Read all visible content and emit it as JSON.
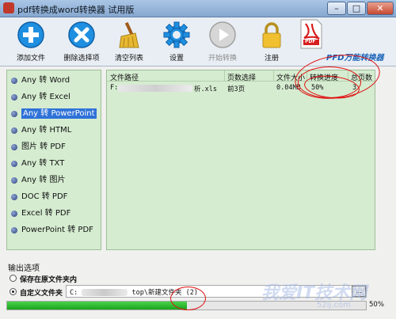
{
  "window": {
    "title": "pdf转换成word转换器 试用版"
  },
  "toolbar": {
    "add": "添加文件",
    "delete": "删除选择项",
    "clear": "清空列表",
    "settings": "设置",
    "start": "开始转换",
    "register": "注册",
    "brand": "PFD万能转换器",
    "pdf_label": "PDF"
  },
  "sidebar": {
    "items": [
      {
        "label": "Any 转 Word"
      },
      {
        "label": "Any 转 Excel"
      },
      {
        "label": "Any 转 PowerPoint"
      },
      {
        "label": "Any 转 HTML"
      },
      {
        "label": "图片 转 PDF"
      },
      {
        "label": "Any 转 TXT"
      },
      {
        "label": "Any 转 图片"
      },
      {
        "label": "DOC 转 PDF"
      },
      {
        "label": "Excel 转 PDF"
      },
      {
        "label": "PowerPoint 转 PDF"
      }
    ]
  },
  "table": {
    "columns": [
      "文件路径",
      "页数选择",
      "文件大小",
      "转换进度",
      "总页数"
    ],
    "rows": [
      {
        "path_prefix": "F:",
        "path_suffix": "析.xls",
        "pages": "前3页",
        "size": "0.04MB",
        "progress": "50%",
        "total": "3"
      }
    ]
  },
  "output": {
    "label": "输出选项",
    "option_original": "保存在原文件夹内",
    "option_custom": "自定义文件夹",
    "path_prefix": "C:",
    "path_suffix": "top\\新建文件夹 (2)",
    "browse": "...",
    "progress_percent": 50,
    "progress_text": "50%"
  },
  "watermark": {
    "text": "我爱IT技术网",
    "url": "52ij.com"
  },
  "colors": {
    "accent": "#1a63b8",
    "progress": "#19a51c",
    "annotation": "#e01010"
  }
}
